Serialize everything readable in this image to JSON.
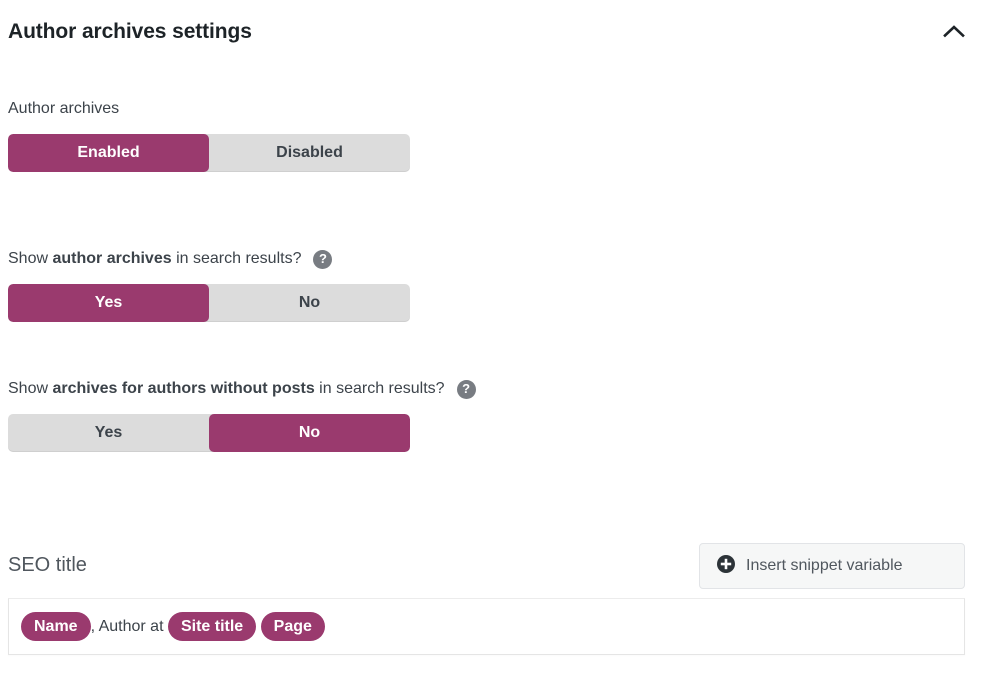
{
  "header": {
    "title": "Author archives settings",
    "collapse_icon": "chevron-up-icon"
  },
  "colors": {
    "accent": "#9a3a6e",
    "track": "#dcdcdc",
    "text": "#3c434a",
    "help_icon_bg": "#787c82"
  },
  "fields": [
    {
      "label_plain": "Author archives",
      "label_bold": "",
      "label_suffix": "",
      "has_help": false,
      "options": [
        "Enabled",
        "Disabled"
      ],
      "selected_index": 0
    },
    {
      "label_plain": "Show ",
      "label_bold": "author archives",
      "label_suffix": " in search results?",
      "has_help": true,
      "help_icon": "question-mark-icon",
      "options": [
        "Yes",
        "No"
      ],
      "selected_index": 0
    },
    {
      "label_plain": "Show ",
      "label_bold": "archives for authors without posts",
      "label_suffix": " in search results?",
      "has_help": true,
      "help_icon": "question-mark-icon",
      "options": [
        "Yes",
        "No"
      ],
      "selected_index": 1
    }
  ],
  "seo_title": {
    "label": "SEO title",
    "snippet_button": {
      "label": "Insert snippet variable",
      "icon": "plus-circle-icon"
    },
    "tokens": [
      {
        "type": "variable",
        "text": "Name"
      },
      {
        "type": "text",
        "text": ", Author at "
      },
      {
        "type": "variable",
        "text": "Site title"
      },
      {
        "type": "text",
        "text": " "
      },
      {
        "type": "variable",
        "text": "Page"
      }
    ]
  }
}
